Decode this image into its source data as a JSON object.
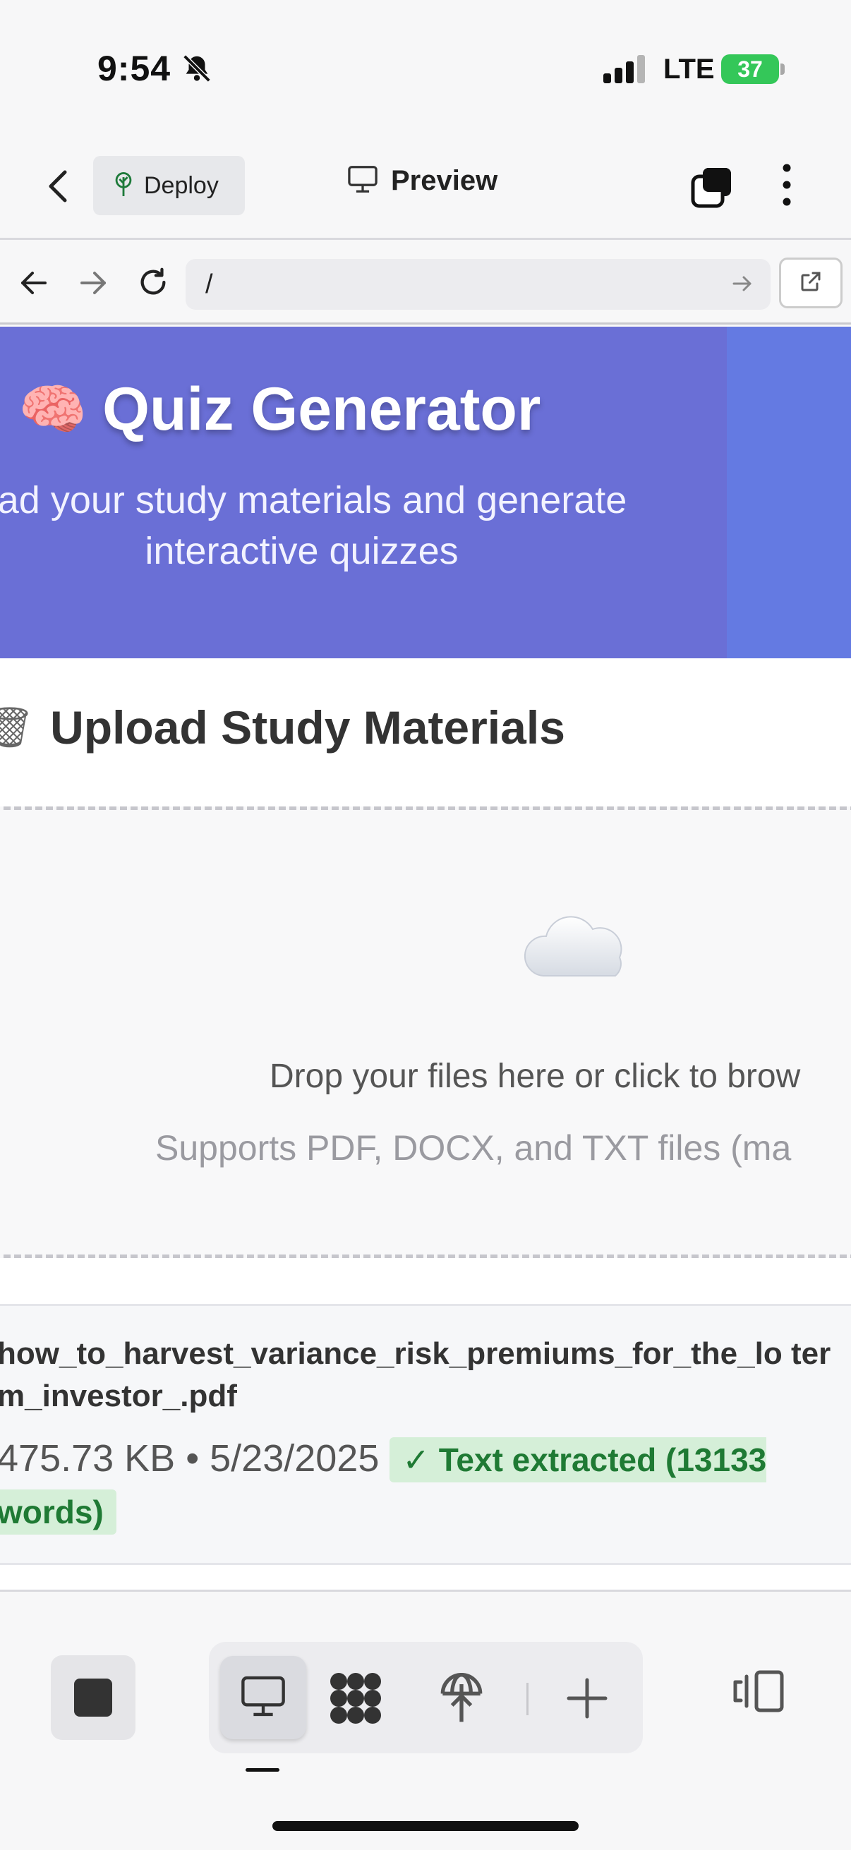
{
  "status_bar": {
    "time": "9:54",
    "network": "LTE",
    "battery": "37"
  },
  "toolbar": {
    "deploy_label": "Deploy",
    "preview_label": "Preview",
    "icons": [
      "back-chevron-icon",
      "deploy-tree-icon",
      "monitor-icon",
      "tabs-icon",
      "more-vertical-icon"
    ]
  },
  "browser": {
    "url": "/"
  },
  "hero": {
    "emoji": "🧠",
    "title": "Quiz Generator",
    "subtitle": "oad your study materials and generate interactive quizzes"
  },
  "upload": {
    "emoji": "🗑",
    "heading": "Upload Study Materials",
    "cloud_emoji": "☁",
    "drop_text": "Drop your files here or click to brow",
    "support_text": "Supports PDF, DOCX, and TXT files (ma"
  },
  "file": {
    "name": "how_to_harvest_variance_risk_premiums_for_the_lo term_investor_.pdf",
    "size": "475.73 KB",
    "separator": "•",
    "date": "5/23/2025",
    "status": "✓ Text extracted (13133 words)"
  },
  "colors": {
    "hero_bg": "#6a6fd6",
    "hero_bg_right": "#647ae2",
    "badge_bg": "#d5efd8",
    "badge_text": "#1f7a34",
    "battery": "#34c759"
  }
}
